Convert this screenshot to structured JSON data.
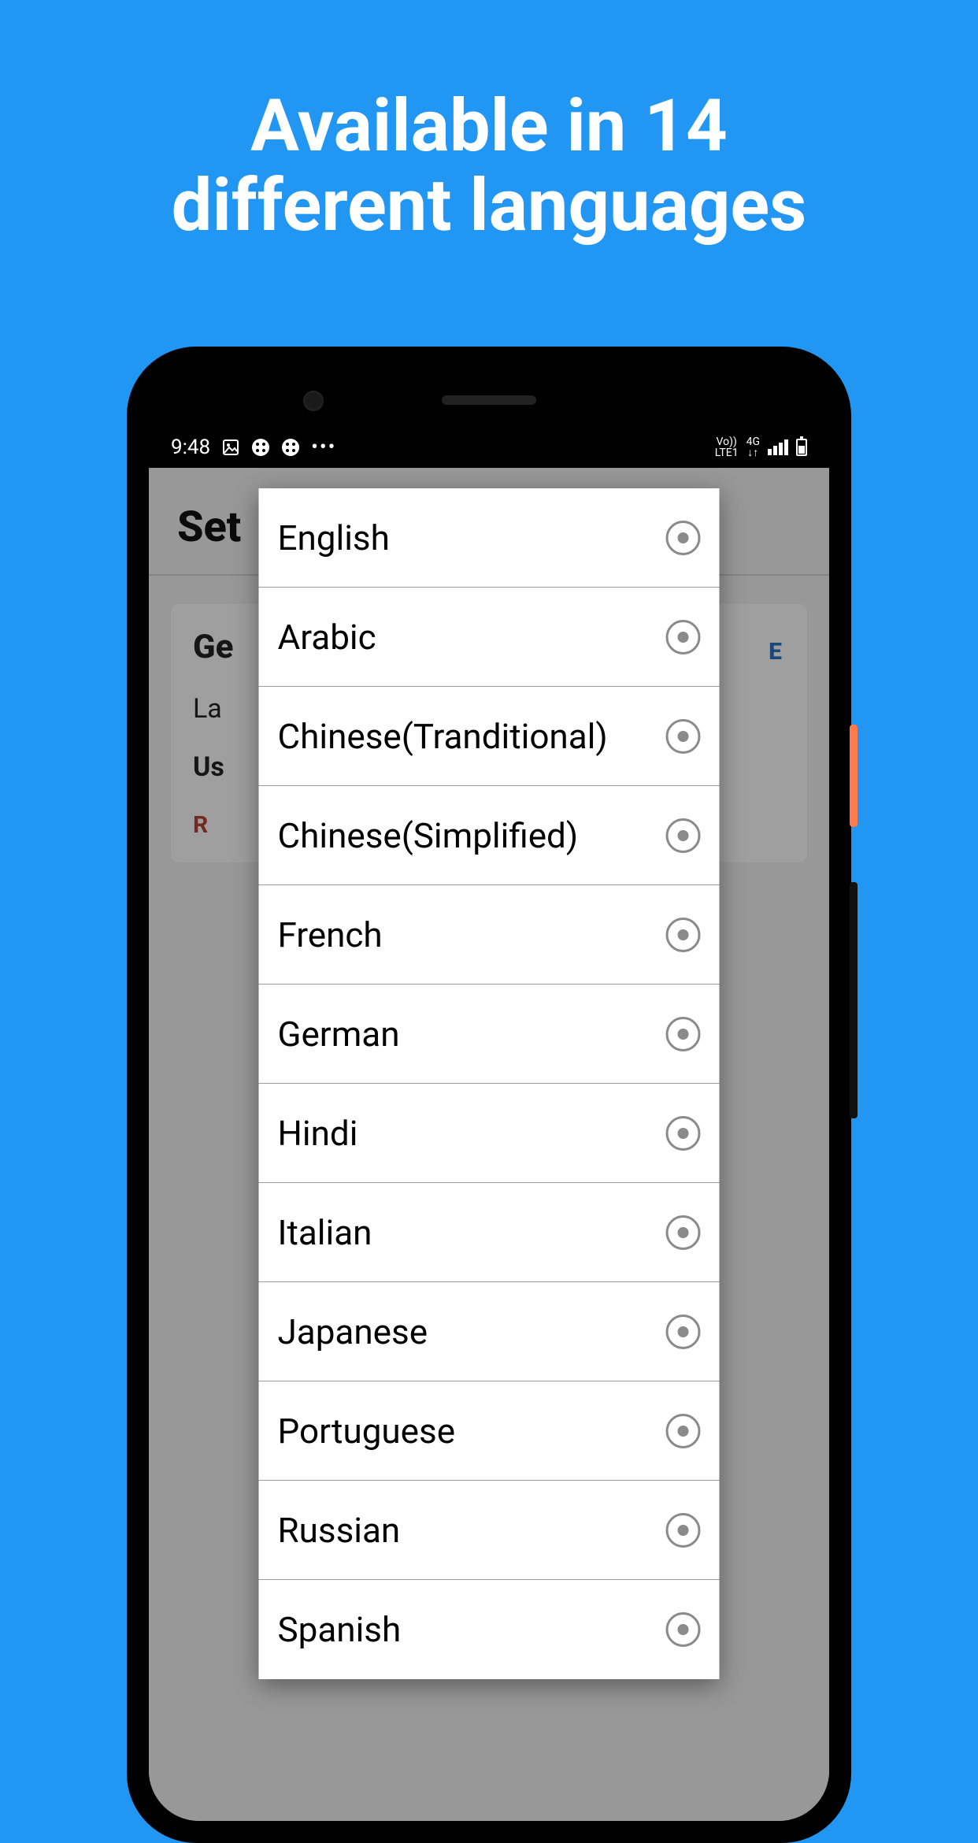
{
  "headline_line1": "Available in 14",
  "headline_line2": "different languages",
  "status_bar": {
    "time": "9:48",
    "network_label_top": "Vo))",
    "network_label_bottom": "LTE1",
    "network_4g": "4G"
  },
  "background_screen": {
    "header_title": "Set",
    "card_title_partial": "Ge",
    "row1_partial": "La",
    "row2_partial": "Us",
    "action_partial": "R",
    "side_letter": "E"
  },
  "dialog": {
    "languages": [
      "English",
      "Arabic",
      "Chinese(Tranditional)",
      "Chinese(Simplified)",
      "French",
      "German",
      "Hindi",
      "Italian",
      "Japanese",
      "Portuguese",
      "Russian",
      "Spanish"
    ]
  }
}
